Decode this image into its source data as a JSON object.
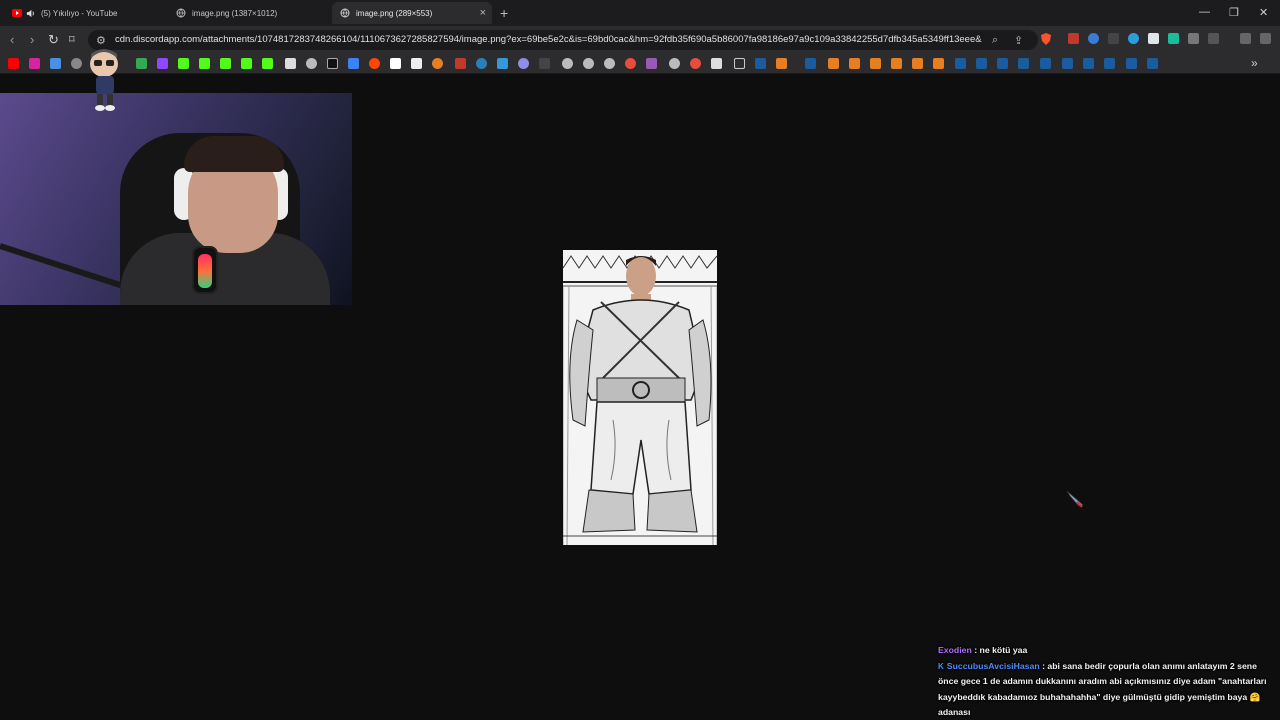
{
  "tabs": [
    {
      "title": "(5) Yıkılıyo - YouTube",
      "active": false,
      "icon": "youtube-icon"
    },
    {
      "title": "image.png (1387×1012)",
      "active": false,
      "icon": "globe-icon"
    },
    {
      "title": "image.png (289×553)",
      "active": true,
      "icon": "globe-icon"
    }
  ],
  "address_bar": {
    "url": "cdn.discordapp.com/attachments/1074817283748266104/1110673627285827594/image.png?ex=69be5e2c&is=69bd0cac&hm=92fdb35f690a5b86007fa98186e97a9c109a33842255d7dfb345a5349ff13eee&"
  },
  "chat": {
    "messages": [
      {
        "user": "Exodien",
        "sep": ":",
        "text": "ne kötü yaa"
      },
      {
        "user": "SuccubusAvcisiHasan",
        "sep": ":",
        "text": "abi sana bedir çopurla olan anımı anlatayım 2 sene önce gece 1 de adamın dukkanını aradım abi açıkmısınız diye adam \"anahtarları kayybeddık kabadamıoz buhahahahha\" diye gülmüştü gidip yemiştim baya 🤗 adanası"
      }
    ]
  },
  "colors": {
    "tab_bg": "#1c1c1e",
    "toolbar_bg": "#2c2c2f",
    "page_bg": "#0e0e0e",
    "chat_user1": "#b06cff",
    "chat_user2": "#4b8cff"
  }
}
